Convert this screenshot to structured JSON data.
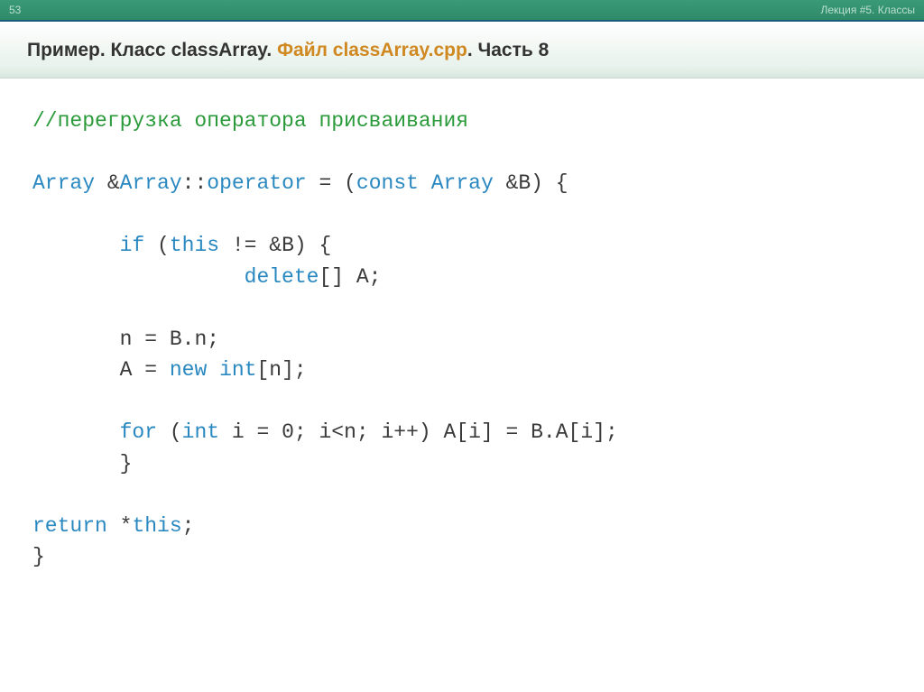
{
  "header": {
    "page_number": "53",
    "lecture_label": "Лекция #5. Классы"
  },
  "title": {
    "part1": "Пример. Класс classArray. ",
    "accent": "Файл classArray.cpp",
    "part2": ". Часть 8"
  },
  "code": {
    "comment": "//перегрузка оператора присваивания",
    "sig_array1": "Array ",
    "sig_amp1": "&",
    "sig_array2": "Array",
    "sig_scope": "::",
    "sig_operator": "operator ",
    "sig_eq_open": "= (",
    "sig_const": "const ",
    "sig_array3": "Array ",
    "sig_amp_b": "&B) {",
    "if_kw": "if ",
    "if_open": "(",
    "this_kw1": "this ",
    "if_cond_rest": "!= &B) {",
    "delete_kw": "delete",
    "delete_rest": "[] A;",
    "n_assign": "n = B.n;",
    "a_prefix": "A = ",
    "new_kw": "new ",
    "int_kw1": "int",
    "new_rest": "[n];",
    "for_kw": "for ",
    "for_open": "(",
    "int_kw2": "int ",
    "for_rest": "i = 0; i<n; i++) A[i] = B.A[i];",
    "close_brace1": "}",
    "return_kw": "return ",
    "star": "*",
    "this_kw2": "this",
    "semicolon": ";",
    "close_brace2": "}"
  }
}
